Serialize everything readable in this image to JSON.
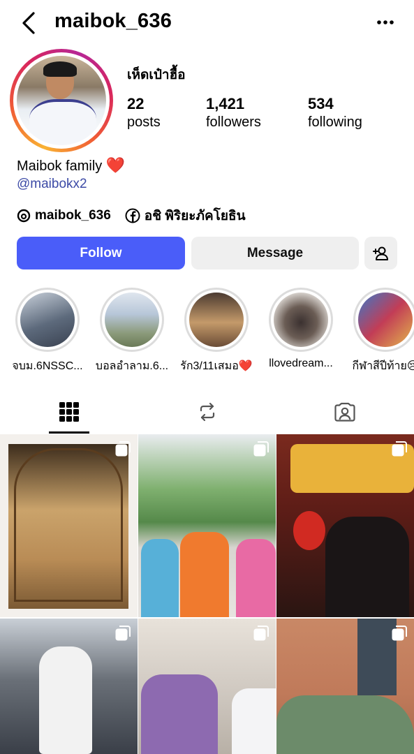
{
  "header": {
    "username": "maibok_636"
  },
  "profile": {
    "display_name": "เห็ดเป๋าฮื้อ",
    "stats": {
      "posts": {
        "value": "22",
        "label": "posts"
      },
      "followers": {
        "value": "1,421",
        "label": "followers"
      },
      "following": {
        "value": "534",
        "label": "following"
      }
    },
    "bio": "Maibok family",
    "bio_emoji": "❤️",
    "bio_link": "@maibokx2",
    "threads_handle": "maibok_636",
    "facebook_name": "อชิ พิริยะภัคโยธิน"
  },
  "actions": {
    "follow": "Follow",
    "message": "Message"
  },
  "highlights": [
    {
      "label": "จบม.6NSSC...",
      "colors": [
        "#5d6a7c",
        "#c8d0da"
      ]
    },
    {
      "label": "บอลอำลาม.6...",
      "colors": [
        "#b7c6d8",
        "#8b9a7a"
      ]
    },
    {
      "label": "รัก3/11เสมอ❤️",
      "colors": [
        "#4b3a30",
        "#c49a6a"
      ]
    },
    {
      "label": "llovedream...",
      "colors": [
        "#d9d4cf",
        "#3b3130"
      ]
    },
    {
      "label": "กีฬาสีปีท้าย😢",
      "colors": [
        "#c23d56",
        "#3a78c8"
      ]
    }
  ],
  "tabs": [
    {
      "name": "grid",
      "icon": "grid-icon"
    },
    {
      "name": "reposts",
      "icon": "repost-icon"
    },
    {
      "name": "tagged",
      "icon": "tagged-icon"
    }
  ],
  "posts": [
    {
      "desc": "cage photo",
      "colors": [
        "#caa36b",
        "#6a4c2a"
      ]
    },
    {
      "desc": "friends team jerseys",
      "colors": [
        "#7fb06f",
        "#e7e4df"
      ]
    },
    {
      "desc": "night market",
      "colors": [
        "#5e1d17",
        "#d9a33a"
      ]
    },
    {
      "desc": "sitting on rail",
      "colors": [
        "#3a3f48",
        "#c9cfd6"
      ]
    },
    {
      "desc": "school corridor",
      "colors": [
        "#cfc8c0",
        "#8d6ab0"
      ]
    },
    {
      "desc": "brick building",
      "colors": [
        "#c07a5a",
        "#6c8b6a"
      ]
    }
  ],
  "theme": {
    "follow_blue": "#4a5df9",
    "link_blue": "#3c4aa6",
    "button_gray": "#efefef"
  }
}
